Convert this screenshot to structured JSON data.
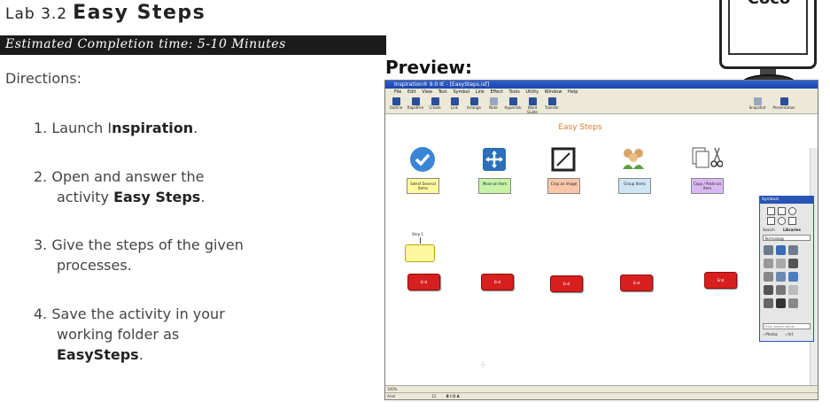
{
  "lab": {
    "number": "Lab 3.2",
    "title": "Easy Steps",
    "estimated_time": "Estimated Completion time: 5-10 Minutes",
    "directions_label": "Directions:"
  },
  "steps": [
    {
      "num": "1.",
      "pre": "Launch I",
      "bold": "nspiration",
      "post": ".",
      "cont_pre": "",
      "cont_bold": "",
      "cont_post": "",
      "cont2": ""
    },
    {
      "num": "2.",
      "pre": "Open and answer the",
      "bold": "",
      "post": "",
      "cont_pre": "activity ",
      "cont_bold": "Easy Steps",
      "cont_post": ".",
      "cont2": ""
    },
    {
      "num": "3.",
      "pre": "Give the steps of the given",
      "bold": "",
      "post": "",
      "cont_pre": "processes.",
      "cont_bold": "",
      "cont_post": "",
      "cont2": ""
    },
    {
      "num": "4.",
      "pre": "Save the activity in your",
      "bold": "",
      "post": "",
      "cont_pre": "working folder as",
      "cont_bold": "",
      "cont_post": "",
      "cont2": "EasySteps"
    }
  ],
  "monitor_label": "Coco",
  "preview_label": "Preview:",
  "app": {
    "title": "Inspiration® 9.0 IE - [EasySteps.isf]",
    "menus": [
      "File",
      "Edit",
      "View",
      "Text",
      "Symbol",
      "Link",
      "Effect",
      "Tools",
      "Utility",
      "Window",
      "Help"
    ],
    "toolbar": [
      "Outline",
      "RapidFire",
      "Create",
      "Link",
      "Arrange",
      "Note",
      "Hyperlink",
      "Word Guide",
      "Transfer"
    ],
    "toolbar_right": [
      "Snapshot",
      "Presentation"
    ],
    "canvas_title": "Easy Steps",
    "boxes": [
      {
        "label": "Select Several Items",
        "color": "#fffaa0"
      },
      {
        "label": "Move an Item",
        "color": "#c6f3a8"
      },
      {
        "label": "Crop an Image",
        "color": "#f7c6a8"
      },
      {
        "label": "Group Items",
        "color": "#cfe6f5"
      },
      {
        "label": "Copy / Paste an Item",
        "color": "#d9b9f2"
      }
    ],
    "icons": [
      "checkmark-icon",
      "move-arrows-icon",
      "crop-icon",
      "group-people-icon",
      "copy-paste-scissors-icon"
    ],
    "step_label": "Step 1",
    "end_label": "End",
    "symbols": {
      "title": "Symbols",
      "search_tab": "Search",
      "libraries_tab": "Libraries",
      "category": "Technology",
      "search_placeholder": "Enter search words",
      "photos": "Photos",
      "art": "Art"
    },
    "zoom": "100%",
    "font": "Arial",
    "font_size": "12",
    "format_buttons": "B  I  U  A"
  }
}
